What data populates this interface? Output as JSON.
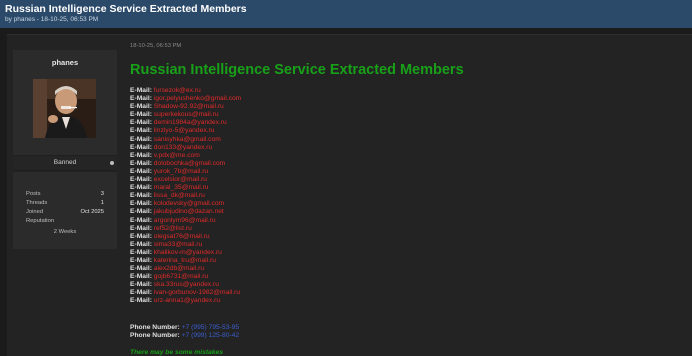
{
  "thread": {
    "title": "Russian Intelligence Service Extracted Members",
    "subtitle": "by phanes - 18-10-25, 06:53 PM"
  },
  "author": {
    "username": "phanes",
    "status": "Banned",
    "stats": [
      {
        "label": "Posts",
        "value": "3"
      },
      {
        "label": "Threads",
        "value": "1"
      },
      {
        "label": "Joined",
        "value": "Oct 2025"
      }
    ],
    "reputation_label": "Reputation",
    "reputation_value": "2 Weeks"
  },
  "post": {
    "date": "18-10-25, 06:53 PM",
    "heading": "Russian Intelligence Service Extracted Members",
    "email_label": "E-Mail:",
    "emails": [
      "fursezok@ex.ru",
      "igor.pelyushenko@gmail.com",
      "Shadow-92.92@mail.ru",
      "superkekous@mail.ru",
      "demin1984a@yandex.ru",
      "linzlyo-5@yandex.ru",
      "sanisyhka@gmail.com",
      "don133@yandex.ru",
      "v.pdx@me.com",
      "dolobochka@gmail.com",
      "yurok_7b@mail.ru",
      "excelsior@mail.ru",
      "maral_35@mail.ru",
      "lissa_dk@mail.ru",
      "kolodevsky@gmail.com",
      "jakubjudino@dazan.net",
      "argonlym96@mail.ru",
      "ref52@list.ru",
      "olegsat76@mail.ru",
      "sima33@mail.ru",
      "khalikov-m@yandex.ru",
      "katerina_tru@mail.ru",
      "alex2db@mail.ru",
      "gojb6731@mail.ru",
      "ska.33rus@yandex.ru",
      "ivan-gorbunov-1982@mail.ru",
      "urz-anna1@yandex.ru"
    ],
    "phone_label": "Phone Number:",
    "phones": [
      "+7 (995) 795-53-95",
      "+7 (999) 125-80-42"
    ],
    "note": "There may be some mistakes"
  }
}
